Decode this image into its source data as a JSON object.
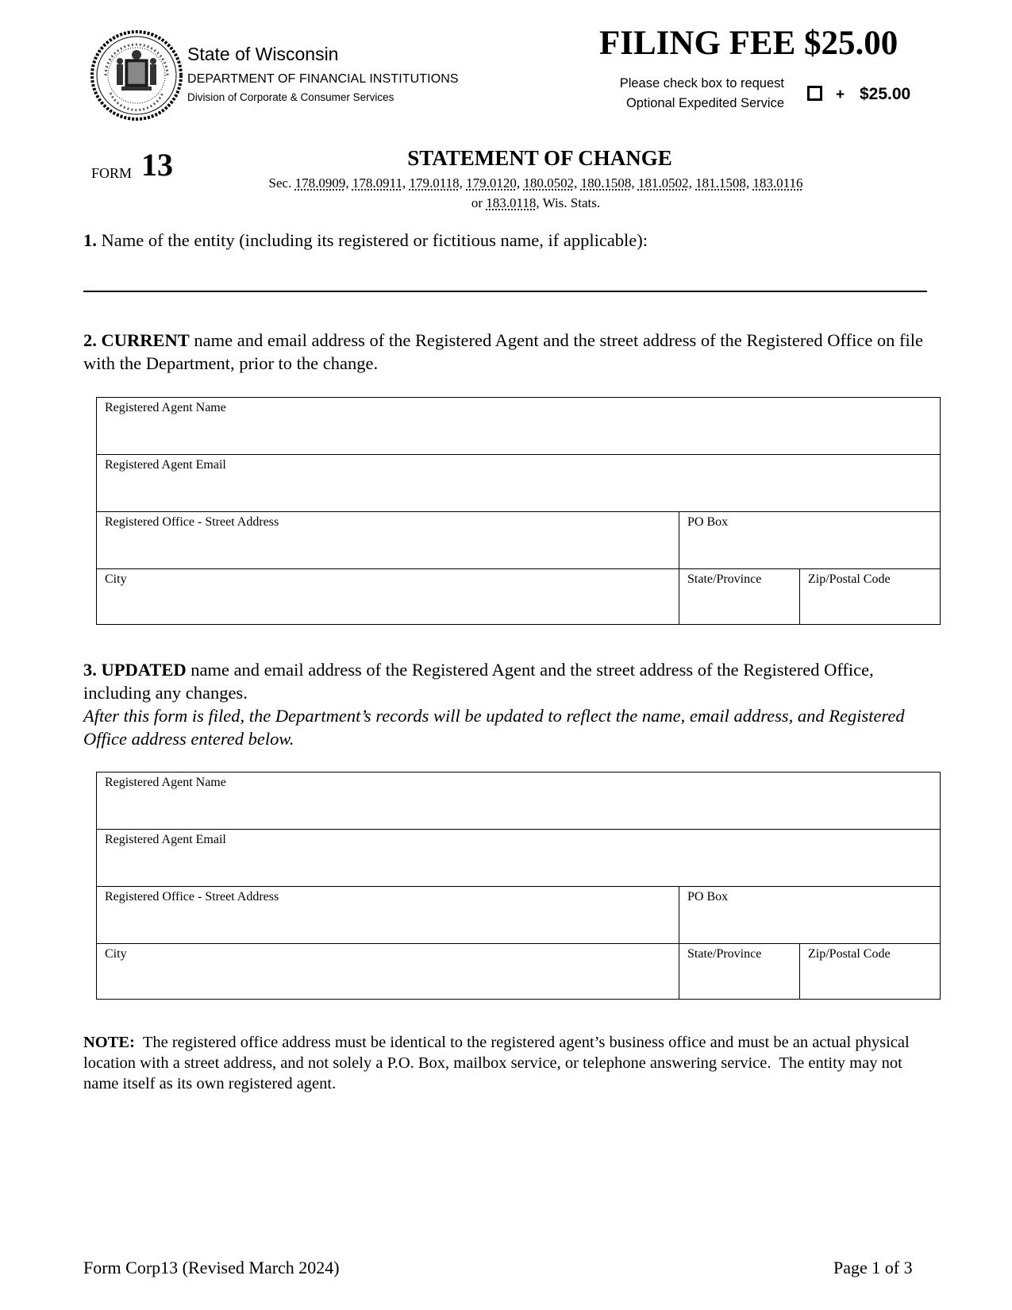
{
  "header": {
    "org_name": "State of Wisconsin",
    "department": "DEPARTMENT OF FINANCIAL INSTITUTIONS",
    "division": "Division of Corporate & Consumer Services",
    "seal_icon": "state-seal-icon",
    "filing_fee_title": "FILING FEE $25.00",
    "expedite_line1": "Please check box to request",
    "expedite_line2": "Optional Expedited Service",
    "expedite_checked": false,
    "expedite_plus": "+",
    "expedite_fee": "$25.00"
  },
  "form": {
    "label": "FORM",
    "number": "13",
    "title": "STATEMENT OF CHANGE",
    "statute_prefix": "Sec.",
    "statutes": [
      "178.0909",
      "178.0911",
      "179.0118",
      "179.0120",
      "180.0502",
      "180.1508",
      "181.0502",
      "181.1508",
      "183.0116"
    ],
    "statute_or": "or",
    "statute_last": "183.0118",
    "statute_suffix": ", Wis. Stats."
  },
  "section1": {
    "number": "1.",
    "text": "Name of the entity (including its registered or fictitious name, if applicable):",
    "value": ""
  },
  "section2": {
    "number": "2.",
    "bold": "CURRENT",
    "text": " name and email address of the Registered Agent and the street address of the Registered Office on file with the Department, prior to the change."
  },
  "section3": {
    "number": "3.",
    "bold": "UPDATED",
    "text": " name and email address of the Registered Agent and the street address of the Registered Office, including any changes.",
    "italic_note": "After this form is filed, the Department’s records will be updated to reflect the name, email address, and Registered Office address entered below."
  },
  "fields": {
    "agent_name": "Registered Agent Name",
    "agent_email": "Registered Agent Email",
    "street": "Registered Office - Street Address",
    "po_box": "PO Box",
    "city": "City",
    "state": "State/Province",
    "zip": "Zip/Postal Code"
  },
  "current_values": {
    "agent_name": "",
    "agent_email": "",
    "street": "",
    "po_box": "",
    "city": "",
    "state": "",
    "zip": ""
  },
  "updated_values": {
    "agent_name": "",
    "agent_email": "",
    "street": "",
    "po_box": "",
    "city": "",
    "state": "",
    "zip": ""
  },
  "note": {
    "label": "NOTE:",
    "text": "  The registered office address must be identical to the registered agent’s business office and must be an actual physical location with a street address, and not solely a P.O. Box, mailbox service, or telephone answering service.  The entity may not name itself as its own registered agent."
  },
  "footer": {
    "form_id": "Form Corp13 (Revised March 2024)",
    "page": "Page 1 of 3"
  }
}
